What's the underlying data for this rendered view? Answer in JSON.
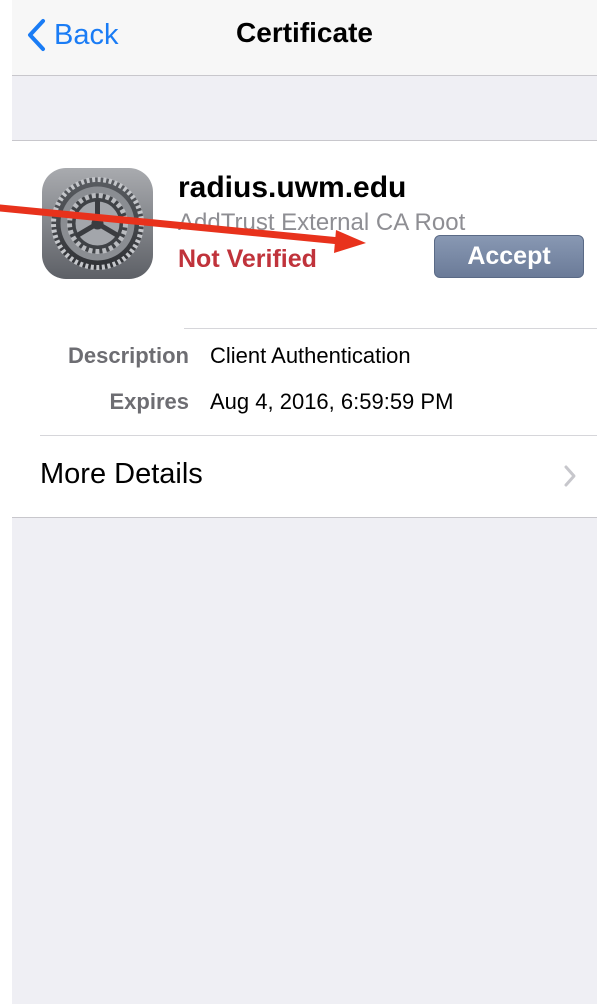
{
  "navbar": {
    "back_label": "Back",
    "title": "Certificate"
  },
  "certificate": {
    "icon": "settings-gear-icon",
    "name": "radius.uwm.edu",
    "issuer": "AddTrust External CA Root",
    "status": "Not Verified",
    "accept_label": "Accept"
  },
  "details": [
    {
      "label": "Description",
      "value": "Client Authentication"
    },
    {
      "label": "Expires",
      "value": "Aug 4, 2016, 6:59:59 PM"
    }
  ],
  "more_details": {
    "label": "More Details"
  },
  "colors": {
    "accent": "#1a7cf5",
    "status_red": "#c0333b",
    "accept_button": "#7888a4",
    "annotation_arrow": "#e8321c"
  }
}
